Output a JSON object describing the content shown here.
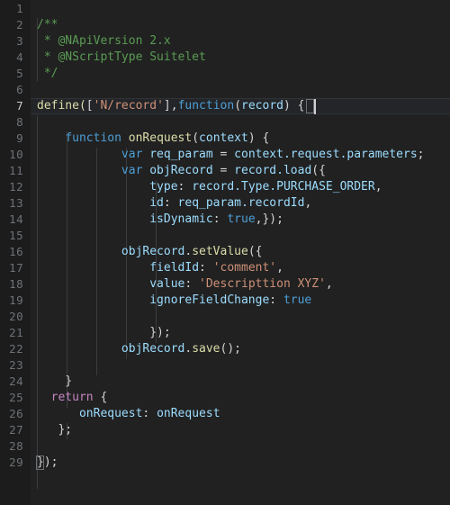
{
  "editor": {
    "language": "javascript",
    "active_line": 7,
    "total_lines": 29,
    "colors": {
      "background": "#212121",
      "gutter_background": "#1c1c1c",
      "active_line_background": "#232528",
      "line_number": "#6e7277",
      "active_line_number": "#c8cdd2",
      "comment": "#5a9c54",
      "keyword": "#4d9fd6",
      "control_keyword": "#c586c0",
      "function_name": "#dcdcaa",
      "string": "#ce9178",
      "identifier": "#9cdcfe",
      "plain_text": "#d4d4d4",
      "indent_guide": "#3a3d41",
      "bracket_match_border": "#6d7175"
    }
  },
  "gutter": {
    "numbers": [
      "1",
      "2",
      "3",
      "4",
      "5",
      "6",
      "7",
      "8",
      "9",
      "10",
      "11",
      "12",
      "13",
      "14",
      "15",
      "16",
      "17",
      "18",
      "19",
      "20",
      "21",
      "22",
      "23",
      "24",
      "25",
      "26",
      "27",
      "28",
      "29"
    ]
  },
  "code": {
    "lines": [
      {
        "n": 1,
        "text": ""
      },
      {
        "n": 2,
        "text": "/**"
      },
      {
        "n": 3,
        "text": " * @NApiVersion 2.x"
      },
      {
        "n": 4,
        "text": " * @NScriptType Suitelet"
      },
      {
        "n": 5,
        "text": " */"
      },
      {
        "n": 6,
        "text": ""
      },
      {
        "n": 7,
        "text": "define(['N/record'],function(record) {"
      },
      {
        "n": 8,
        "text": ""
      },
      {
        "n": 9,
        "text": "    function onRequest(context) {"
      },
      {
        "n": 10,
        "text": "            var req_param = context.request.parameters;"
      },
      {
        "n": 11,
        "text": "            var objRecord = record.load({"
      },
      {
        "n": 12,
        "text": "                type: record.Type.PURCHASE_ORDER,"
      },
      {
        "n": 13,
        "text": "                id: req_param.recordId,"
      },
      {
        "n": 14,
        "text": "                isDynamic: true,});"
      },
      {
        "n": 15,
        "text": ""
      },
      {
        "n": 16,
        "text": "            objRecord.setValue({"
      },
      {
        "n": 17,
        "text": "                fieldId: 'comment',"
      },
      {
        "n": 18,
        "text": "                value: 'Descripttion XYZ',"
      },
      {
        "n": 19,
        "text": "                ignoreFieldChange: true"
      },
      {
        "n": 20,
        "text": ""
      },
      {
        "n": 21,
        "text": "                });"
      },
      {
        "n": 22,
        "text": "            objRecord.save();"
      },
      {
        "n": 23,
        "text": ""
      },
      {
        "n": 24,
        "text": "    }"
      },
      {
        "n": 25,
        "text": "  return {"
      },
      {
        "n": 26,
        "text": "      onRequest: onRequest"
      },
      {
        "n": 27,
        "text": "   };"
      },
      {
        "n": 28,
        "text": ""
      },
      {
        "n": 29,
        "text": "});"
      }
    ],
    "tokens": {
      "l2_comment": "/**",
      "l3_comment": " * @NApiVersion 2.x",
      "l4_comment": " * @NScriptType Suitelet",
      "l5_comment": " */",
      "l7_define": "define(",
      "l7_open_bracket": "[",
      "l7_module_string": "'N/record'",
      "l7_close_bracket": "],",
      "l7_function_kw": "function",
      "l7_paren_open": "(",
      "l7_param": "record",
      "l7_paren_close": ") ",
      "l7_brace": "{",
      "l9_indent": "    ",
      "l9_function_kw": "function",
      "l9_space": " ",
      "l9_name": "onRequest",
      "l9_paren_open": "(",
      "l9_param": "context",
      "l9_tail": ") {",
      "l10_indent": "            ",
      "l10_var": "var",
      "l10_name": " req_param",
      "l10_eq": " = ",
      "l10_expr": "context.request.parameters",
      "l10_semi": ";",
      "l11_indent": "            ",
      "l11_var": "var",
      "l11_name": " objRecord",
      "l11_eq": " = ",
      "l11_expr": "record.load",
      "l11_tail": "({",
      "l12_indent": "                ",
      "l12_key": "type",
      "l12_colon": ": ",
      "l12_value": "record.Type.PURCHASE_ORDER",
      "l12_comma": ",",
      "l13_indent": "                ",
      "l13_key": "id",
      "l13_colon": ": ",
      "l13_value": "req_param.recordId",
      "l13_comma": ",",
      "l14_indent": "                ",
      "l14_key": "isDynamic",
      "l14_colon": ": ",
      "l14_value": "true",
      "l14_tail": ",});",
      "l16_indent": "            ",
      "l16_obj": "objRecord",
      "l16_dot": ".",
      "l16_method": "setValue",
      "l16_tail": "({",
      "l17_indent": "                ",
      "l17_key": "fieldId",
      "l17_colon": ": ",
      "l17_value": "'comment'",
      "l17_comma": ",",
      "l18_indent": "                ",
      "l18_key": "value",
      "l18_colon": ": ",
      "l18_value": "'Descripttion XYZ'",
      "l18_comma": ",",
      "l19_indent": "                ",
      "l19_key": "ignoreFieldChange",
      "l19_colon": ": ",
      "l19_value": "true",
      "l21_text": "                });",
      "l22_indent": "            ",
      "l22_obj": "objRecord",
      "l22_dot": ".",
      "l22_method": "save",
      "l22_tail": "();",
      "l24_text": "    }",
      "l25_indent": "  ",
      "l25_return": "return",
      "l25_tail": " {",
      "l26_indent": "      ",
      "l26_key": "onRequest",
      "l26_colon": ": ",
      "l26_value": "onRequest",
      "l27_text": "   };",
      "l29_brace": "}",
      "l29_tail": ");"
    }
  }
}
